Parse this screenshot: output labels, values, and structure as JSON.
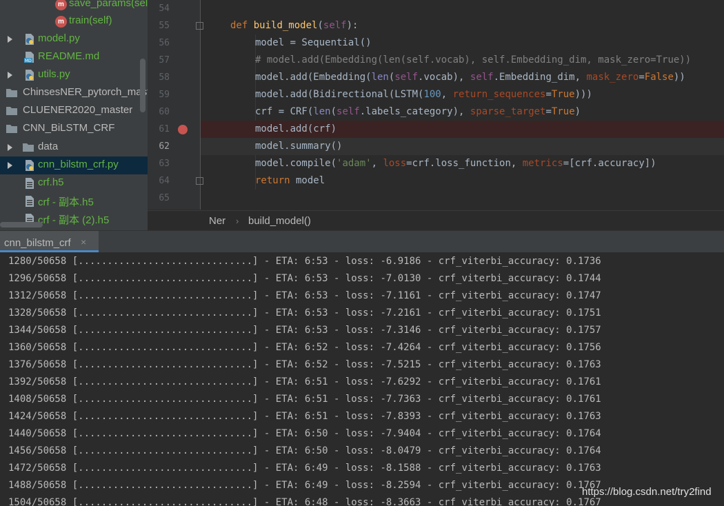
{
  "project_tree": {
    "items": [
      {
        "label": "save_params(self)",
        "type": "method",
        "color": "green"
      },
      {
        "label": "train(self)",
        "type": "method",
        "color": "green"
      },
      {
        "label": "model.py",
        "type": "python-file",
        "color": "green"
      },
      {
        "label": "README.md",
        "type": "markdown-file",
        "color": "green"
      },
      {
        "label": "utils.py",
        "type": "python-file",
        "color": "green"
      },
      {
        "label": "ChinsesNER_pytorch_master",
        "type": "folder",
        "color": "light"
      },
      {
        "label": "CLUENER2020_master",
        "type": "folder",
        "color": "light"
      },
      {
        "label": "CNN_BiLSTM_CRF",
        "type": "folder",
        "color": "light"
      },
      {
        "label": "data",
        "type": "folder",
        "color": "light"
      },
      {
        "label": "cnn_bilstm_crf.py",
        "type": "python-file",
        "color": "green"
      },
      {
        "label": "crf.h5",
        "type": "data-file",
        "color": "green"
      },
      {
        "label": "crf - 副本.h5",
        "type": "data-file",
        "color": "green"
      },
      {
        "label": "crf - 副本 (2).h5",
        "type": "data-file",
        "color": "green"
      }
    ]
  },
  "editor": {
    "line_numbers": [
      "54",
      "55",
      "56",
      "57",
      "58",
      "59",
      "60",
      "61",
      "62",
      "63",
      "64",
      "65"
    ],
    "code": {
      "l55": {
        "kw_def": "def",
        "name": "build_model",
        "self": "self",
        "rest": "):"
      },
      "l56": {
        "text": "model = Sequential()"
      },
      "l57": {
        "text": "# model.add(Embedding(len(self.vocab), self.Embedding_dim, mask_zero=True))"
      },
      "l58": {
        "a": "model.add(Embedding(",
        "len": "len",
        "b": "(",
        "self1": "self",
        "c": ".vocab), ",
        "self2": "self",
        "d": ".Embedding_dim, ",
        "kwarg": "mask_zero",
        "e": "=",
        "val": "False",
        "f": "))"
      },
      "l59": {
        "a": "model.add(Bidirectional(LSTM(",
        "num": "100",
        "b": ", ",
        "kwarg": "return_sequences",
        "c": "=",
        "val": "True",
        "d": ")))"
      },
      "l60": {
        "a": "crf = CRF(",
        "len": "len",
        "b": "(",
        "self": "self",
        "c": ".labels_category), ",
        "kwarg": "sparse_target",
        "d": "=",
        "val": "True",
        "e": ")"
      },
      "l61": {
        "text": "model.add(crf)"
      },
      "l62": {
        "text": "model.summary()"
      },
      "l63": {
        "a": "model.compile(",
        "str": "'adam'",
        "b": ", ",
        "kw1": "loss",
        "c": "=crf.loss_function, ",
        "kw2": "metrics",
        "d": "=[crf.accuracy])"
      },
      "l64": {
        "kw": "return",
        "rest": " model"
      }
    }
  },
  "breadcrumb": {
    "items": [
      "Ner",
      "build_model()"
    ],
    "separator": "›"
  },
  "run_panel": {
    "tab_label": "cnn_bilstm_crf",
    "close_glyph": "×",
    "lines": [
      "1280/50658 [..............................] - ETA: 6:53 - loss: -6.9186 - crf_viterbi_accuracy: 0.1736",
      "1296/50658 [..............................] - ETA: 6:53 - loss: -7.0130 - crf_viterbi_accuracy: 0.1744",
      "1312/50658 [..............................] - ETA: 6:53 - loss: -7.1161 - crf_viterbi_accuracy: 0.1747",
      "1328/50658 [..............................] - ETA: 6:53 - loss: -7.2161 - crf_viterbi_accuracy: 0.1751",
      "1344/50658 [..............................] - ETA: 6:53 - loss: -7.3146 - crf_viterbi_accuracy: 0.1757",
      "1360/50658 [..............................] - ETA: 6:52 - loss: -7.4264 - crf_viterbi_accuracy: 0.1756",
      "1376/50658 [..............................] - ETA: 6:52 - loss: -7.5215 - crf_viterbi_accuracy: 0.1763",
      "1392/50658 [..............................] - ETA: 6:51 - loss: -7.6292 - crf_viterbi_accuracy: 0.1761",
      "1408/50658 [..............................] - ETA: 6:51 - loss: -7.7363 - crf_viterbi_accuracy: 0.1761",
      "1424/50658 [..............................] - ETA: 6:51 - loss: -7.8393 - crf_viterbi_accuracy: 0.1763",
      "1440/50658 [..............................] - ETA: 6:50 - loss: -7.9404 - crf_viterbi_accuracy: 0.1764",
      "1456/50658 [..............................] - ETA: 6:50 - loss: -8.0479 - crf_viterbi_accuracy: 0.1764",
      "1472/50658 [..............................] - ETA: 6:49 - loss: -8.1588 - crf_viterbi_accuracy: 0.1763",
      "1488/50658 [..............................] - ETA: 6:49 - loss: -8.2594 - crf_viterbi_accuracy: 0.1767",
      "1504/50658 [..............................] - ETA: 6:48 - loss: -8.3663 - crf_viterbi_accuracy: 0.1767"
    ]
  },
  "watermark": "https://blog.csdn.net/try2find",
  "colors": {
    "tree_bg": "#3c3f41",
    "editor_bg": "#2b2b2b",
    "keyword": "#cc7832",
    "function": "#ffc66d",
    "self": "#94558d",
    "string": "#6a8759",
    "number": "#6897bb",
    "breakpoint": "#c75450",
    "selection": "#0d293e"
  }
}
